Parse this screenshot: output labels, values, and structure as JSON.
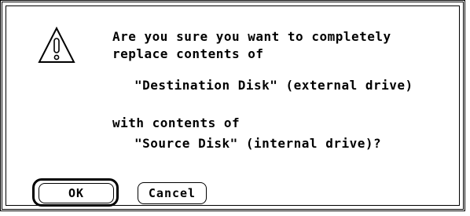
{
  "dialog": {
    "icon": "caution-triangle-icon",
    "message_line1": "Are you sure you want to completely",
    "message_line2": "replace contents of",
    "destination": "\"Destination Disk\" (external drive)",
    "message_line3": "with contents of",
    "source": "\"Source Disk\" (internal drive)?",
    "ok_label": "OK",
    "cancel_label": "Cancel"
  }
}
